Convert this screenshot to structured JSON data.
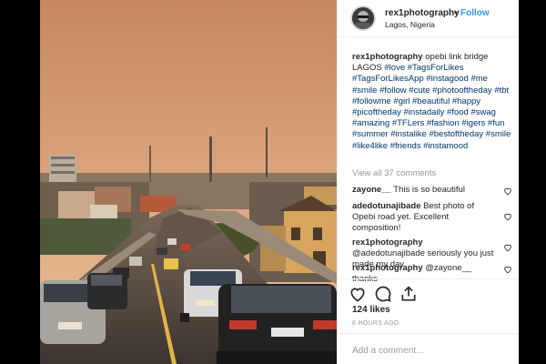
{
  "header": {
    "username": "rex1photography",
    "separator": "•",
    "follow_label": "Follow",
    "location": "Lagos, Nigeria"
  },
  "caption": {
    "username": "rex1photography",
    "text": "opebi link bridge LAGOS",
    "hashtags": "#love #TagsForLikes #TagsForLikesApp #instagood #me #smile #follow #cute #photooftheday #tbt #followme #girl #beautiful #happy #picoftheday #instadaily #food #swag #amazing #TFLers #fashion #igers #fun #summer #instalike #bestoftheday #smile #like4like #friends #instamood"
  },
  "view_all_comments": "View all 37 comments",
  "comments": [
    {
      "user": "zayone__",
      "text": "This is so beautiful"
    },
    {
      "user": "adedotunajibade",
      "text": "Best photo of Opebi road yet. Excellent composition!"
    },
    {
      "user": "rex1photography",
      "text": "@adedotunajibade seriously you just made my day"
    },
    {
      "user": "rex1photography",
      "text": "@zayone__ thanks"
    }
  ],
  "likes": "124 likes",
  "time_ago": "8 HOURS AGO",
  "add_comment_placeholder": "Add a comment...",
  "colors": {
    "link_blue": "#3897f0",
    "hashtag": "#003569",
    "muted": "#999999",
    "sky_top": "#c9875e",
    "sky_bottom": "#e7b98c"
  },
  "icons": {
    "like": "heart-icon",
    "comment": "comment-icon",
    "share": "share-icon"
  }
}
